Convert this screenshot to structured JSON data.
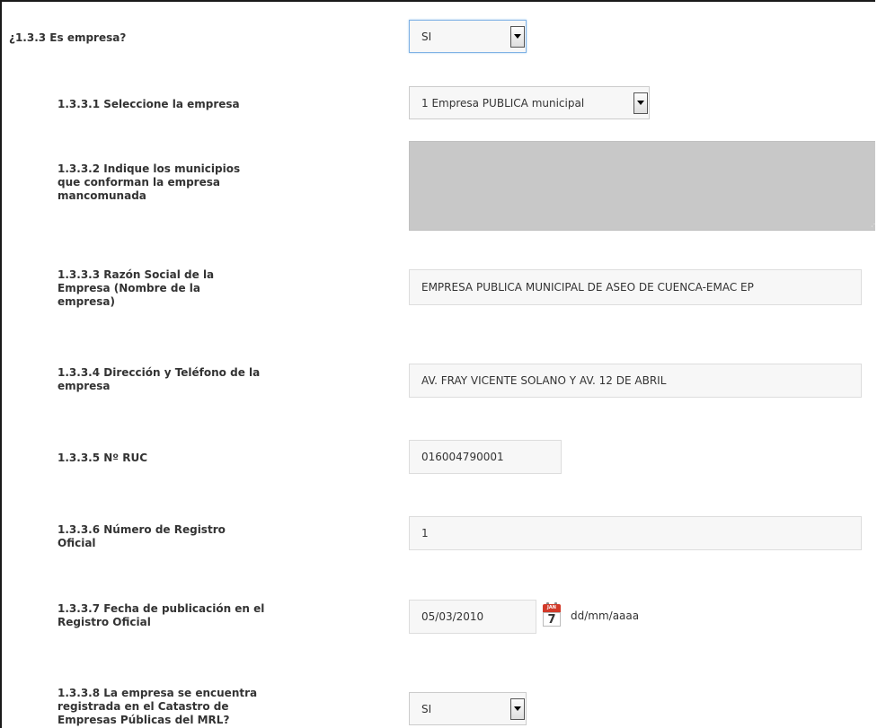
{
  "q133": {
    "label": "¿1.3.3 Es empresa?",
    "value": "SI"
  },
  "q1331": {
    "label": "1.3.3.1 Seleccione la empresa",
    "value": "1 Empresa PUBLICA municipal"
  },
  "q1332": {
    "label": "1.3.3.2 Indique los municipios que conforman la empresa mancomunada",
    "value": ""
  },
  "q1333": {
    "label": "1.3.3.3 Razón Social de la Empresa (Nombre de la empresa)",
    "value": "EMPRESA PUBLICA MUNICIPAL DE ASEO DE CUENCA-EMAC EP"
  },
  "q1334": {
    "label": "1.3.3.4 Dirección y Teléfono de la empresa",
    "value": "AV. FRAY VICENTE SOLANO Y AV. 12 DE ABRIL"
  },
  "q1335": {
    "label": "1.3.3.5 Nº RUC",
    "value": "016004790001"
  },
  "q1336": {
    "label": "1.3.3.6 Número de Registro Oficial",
    "value": "1"
  },
  "q1337": {
    "label": "1.3.3.7 Fecha de publicación en el Registro Oficial",
    "value": "05/03/2010",
    "format_hint": "dd/mm/aaaa",
    "calendar_month": "JAN",
    "calendar_day": "7"
  },
  "q1338": {
    "label": "1.3.3.8 La empresa se encuentra registrada en el Catastro de Empresas Públicas del MRL?",
    "value": "SI"
  },
  "icons": {
    "dropdown": "chevron-down-icon",
    "calendar": "calendar-icon",
    "resize": "resize-grip-icon"
  }
}
